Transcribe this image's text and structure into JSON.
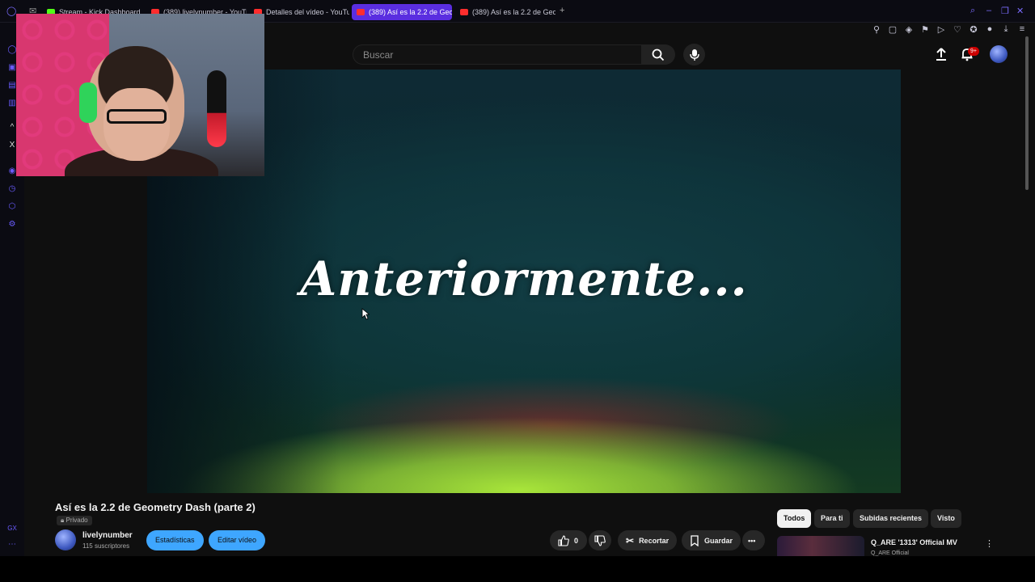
{
  "browser": {
    "tabs": [
      {
        "label": "Stream - Kick Dashboard",
        "favicon": "kick-icon"
      },
      {
        "label": "(389) livelynumber - YouTu",
        "favicon": "youtube-icon"
      },
      {
        "label": "Detalles del vídeo - YouTu",
        "favicon": "youtube-icon"
      },
      {
        "label": "(389) Así es la 2.2 de Geo",
        "favicon": "youtube-icon",
        "active": true
      },
      {
        "label": "(389) Así es la 2.2 de Geo",
        "favicon": "youtube-icon"
      }
    ],
    "new_tab": "+"
  },
  "header": {
    "search_placeholder": "Buscar",
    "notification_badge": "9+"
  },
  "video": {
    "overlay_text": "Anteriormente...",
    "title": "Así es la 2.2 de Geometry Dash (parte 2)",
    "privacy": "Privado"
  },
  "channel": {
    "name": "livelynumber",
    "subscribers": "115 suscriptores",
    "stats_label": "Estadísticas",
    "edit_label": "Editar vídeo"
  },
  "actions": {
    "likes": "0",
    "clip_label": "Recortar",
    "save_label": "Guardar"
  },
  "chips": [
    "Todos",
    "Para ti",
    "Subidas recientes",
    "Visto"
  ],
  "recommendation": {
    "title": "Q_ARE '1313' Official MV",
    "channel": "Q_ARE Official"
  },
  "colors": {
    "accent": "#5a2ee0",
    "button_blue": "#3ea6ff",
    "badge_red": "#cc0000"
  }
}
